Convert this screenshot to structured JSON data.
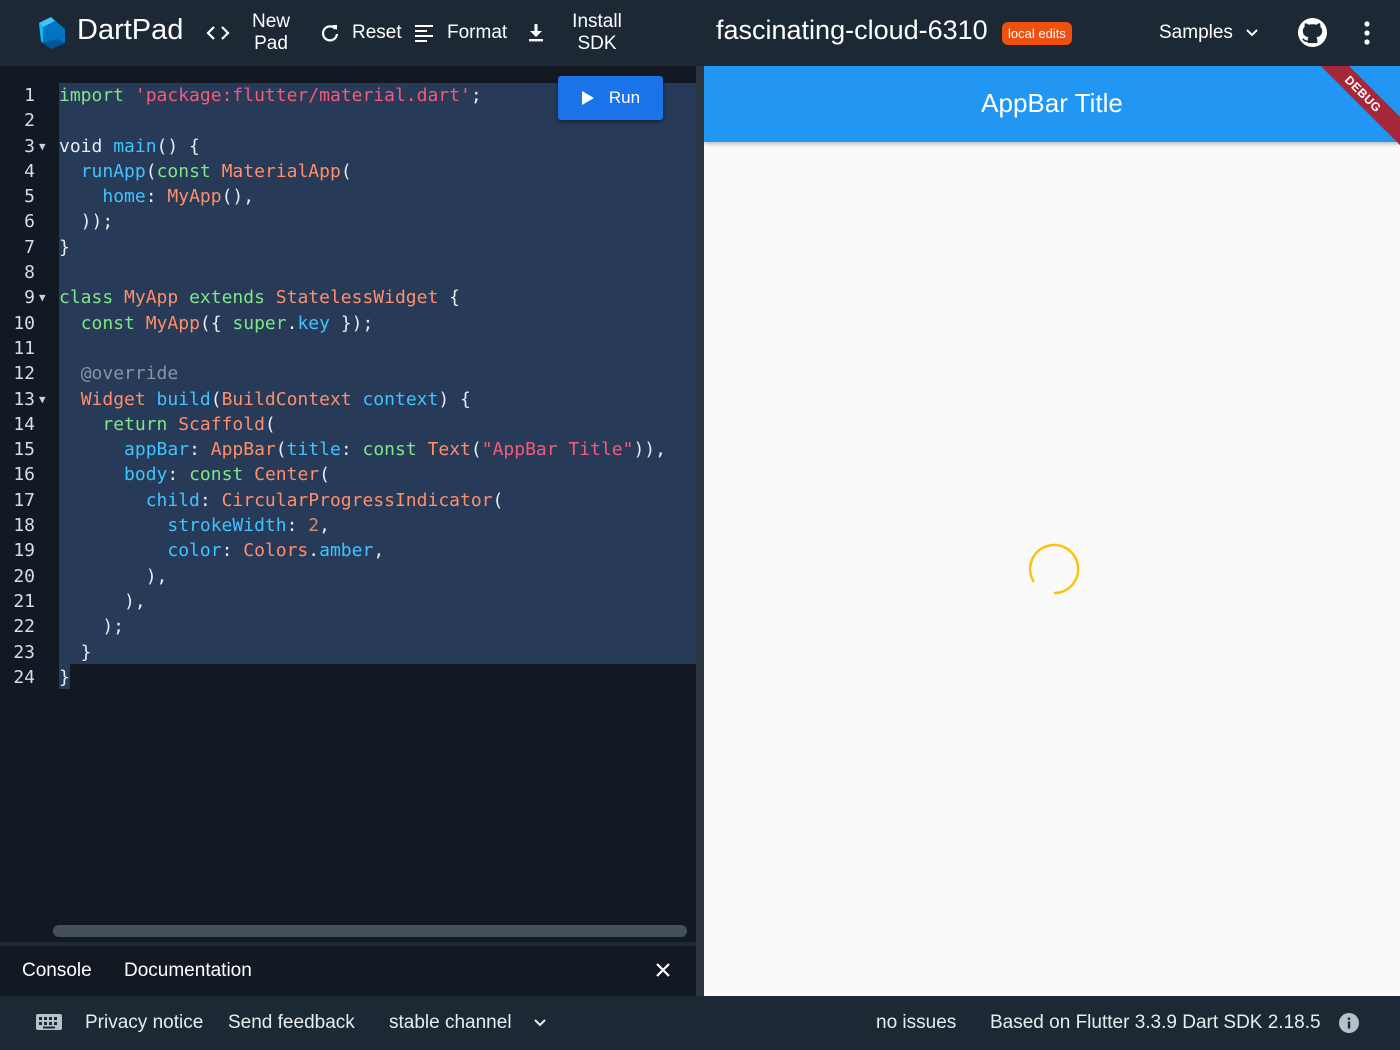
{
  "header": {
    "app_name": "DartPad",
    "new_pad": "New Pad",
    "reset": "Reset",
    "format": "Format",
    "install_sdk": "Install SDK",
    "pad_title": "fascinating-cloud-6310",
    "badge": "local edits",
    "samples": "Samples"
  },
  "editor": {
    "run_label": "Run",
    "line_numbers": [
      "1",
      "2",
      "3",
      "4",
      "5",
      "6",
      "7",
      "8",
      "9",
      "10",
      "11",
      "12",
      "13",
      "14",
      "15",
      "16",
      "17",
      "18",
      "19",
      "20",
      "21",
      "22",
      "23",
      "24"
    ]
  },
  "console": {
    "tab_console": "Console",
    "tab_docs": "Documentation"
  },
  "preview": {
    "appbar_title": "AppBar Title",
    "debug_banner": "DEBUG",
    "spinner_color": "#ffc107"
  },
  "footer": {
    "privacy": "Privacy notice",
    "feedback": "Send feedback",
    "channel": "stable channel",
    "issues": "no issues",
    "version": "Based on Flutter 3.3.9 Dart SDK 2.18.5"
  },
  "colors": {
    "brand_bg": "#1c2834",
    "editor_bg": "#121923",
    "selection": "#273a58",
    "run_button": "#1a73e8",
    "appbar": "#2196f3",
    "badge": "#f0500f"
  }
}
